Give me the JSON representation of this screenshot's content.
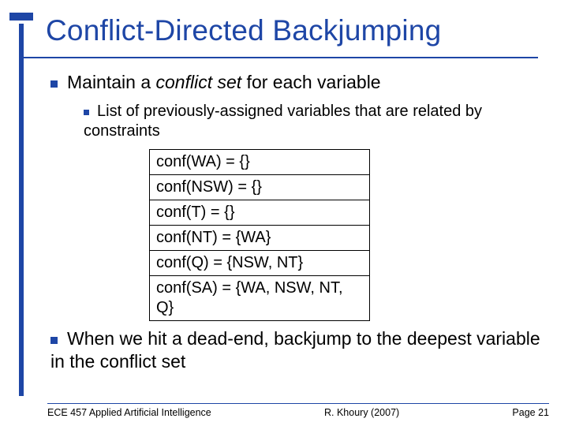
{
  "title": "Conflict-Directed Backjumping",
  "bullet1": {
    "prefix": "Maintain a ",
    "italic": "conflict set",
    "suffix": " for each variable"
  },
  "sub1": "List of previously-assigned variables that are related by constraints",
  "conf": {
    "r0": "conf(WA) = {}",
    "r1": "conf(NSW) = {}",
    "r2": "conf(T) = {}",
    "r3": "conf(NT) = {WA}",
    "r4": "conf(Q) = {NSW, NT}",
    "r5": "conf(SA) = {WA, NSW, NT, Q}"
  },
  "bullet2": "When we hit a dead-end, backjump to the deepest variable in the conflict set",
  "footer": {
    "left": "ECE 457 Applied Artificial Intelligence",
    "mid": "R. Khoury (2007)",
    "right": "Page 21"
  }
}
